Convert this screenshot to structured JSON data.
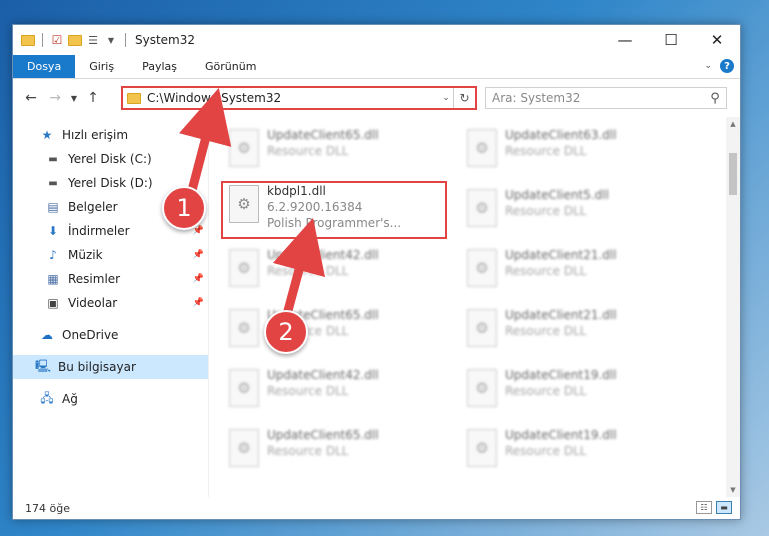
{
  "window": {
    "title": "System32"
  },
  "ribbon": {
    "tabs": [
      "Dosya",
      "Giriş",
      "Paylaş",
      "Görünüm"
    ],
    "help": "?"
  },
  "nav": {
    "address": "C:\\Windows\\System32",
    "search_placeholder": "Ara: System32"
  },
  "sidebar": {
    "items": [
      {
        "label": "Hızlı erişim",
        "icon": "star-icon"
      },
      {
        "label": "Yerel Disk (C:)",
        "icon": "drive-icon"
      },
      {
        "label": "Yerel Disk (D:)",
        "icon": "drive-icon"
      },
      {
        "label": "Belgeler",
        "icon": "documents-icon"
      },
      {
        "label": "İndirmeler",
        "icon": "download-icon"
      },
      {
        "label": "Müzik",
        "icon": "music-icon"
      },
      {
        "label": "Resimler",
        "icon": "pictures-icon"
      },
      {
        "label": "Videolar",
        "icon": "video-icon"
      },
      {
        "label": "OneDrive",
        "icon": "cloud-icon"
      },
      {
        "label": "Bu bilgisayar",
        "icon": "computer-icon"
      },
      {
        "label": "Ağ",
        "icon": "network-icon"
      }
    ]
  },
  "files": [
    {
      "name": "UpdateClient65.dll",
      "sub": "Resource DLL"
    },
    {
      "name": "UpdateClient63.dll",
      "sub": "Resource DLL"
    },
    {
      "name": "kbdpl1.dll",
      "sub": "6.2.9200.16384",
      "sub2": "Polish Programmer's..."
    },
    {
      "name": "UpdateClient5.dll",
      "sub": "Resource DLL"
    },
    {
      "name": "UpdateClient42.dll",
      "sub": "Resource DLL"
    },
    {
      "name": "UpdateClient21.dll",
      "sub": "Resource DLL"
    },
    {
      "name": "UpdateClient65.dll",
      "sub": "Resource DLL"
    },
    {
      "name": "UpdateClient21.dll",
      "sub": "Resource DLL"
    },
    {
      "name": "UpdateClient42.dll",
      "sub": "Resource DLL"
    },
    {
      "name": "UpdateClient19.dll",
      "sub": "Resource DLL"
    },
    {
      "name": "UpdateClient65.dll",
      "sub": "Resource DLL"
    },
    {
      "name": "UpdateClient19.dll",
      "sub": "Resource DLL"
    }
  ],
  "status": {
    "count": "174 öğe"
  },
  "annotations": {
    "step1": "1",
    "step2": "2"
  },
  "colors": {
    "accent": "#1979ca",
    "highlight": "#e24444",
    "selected": "#cce8ff"
  }
}
